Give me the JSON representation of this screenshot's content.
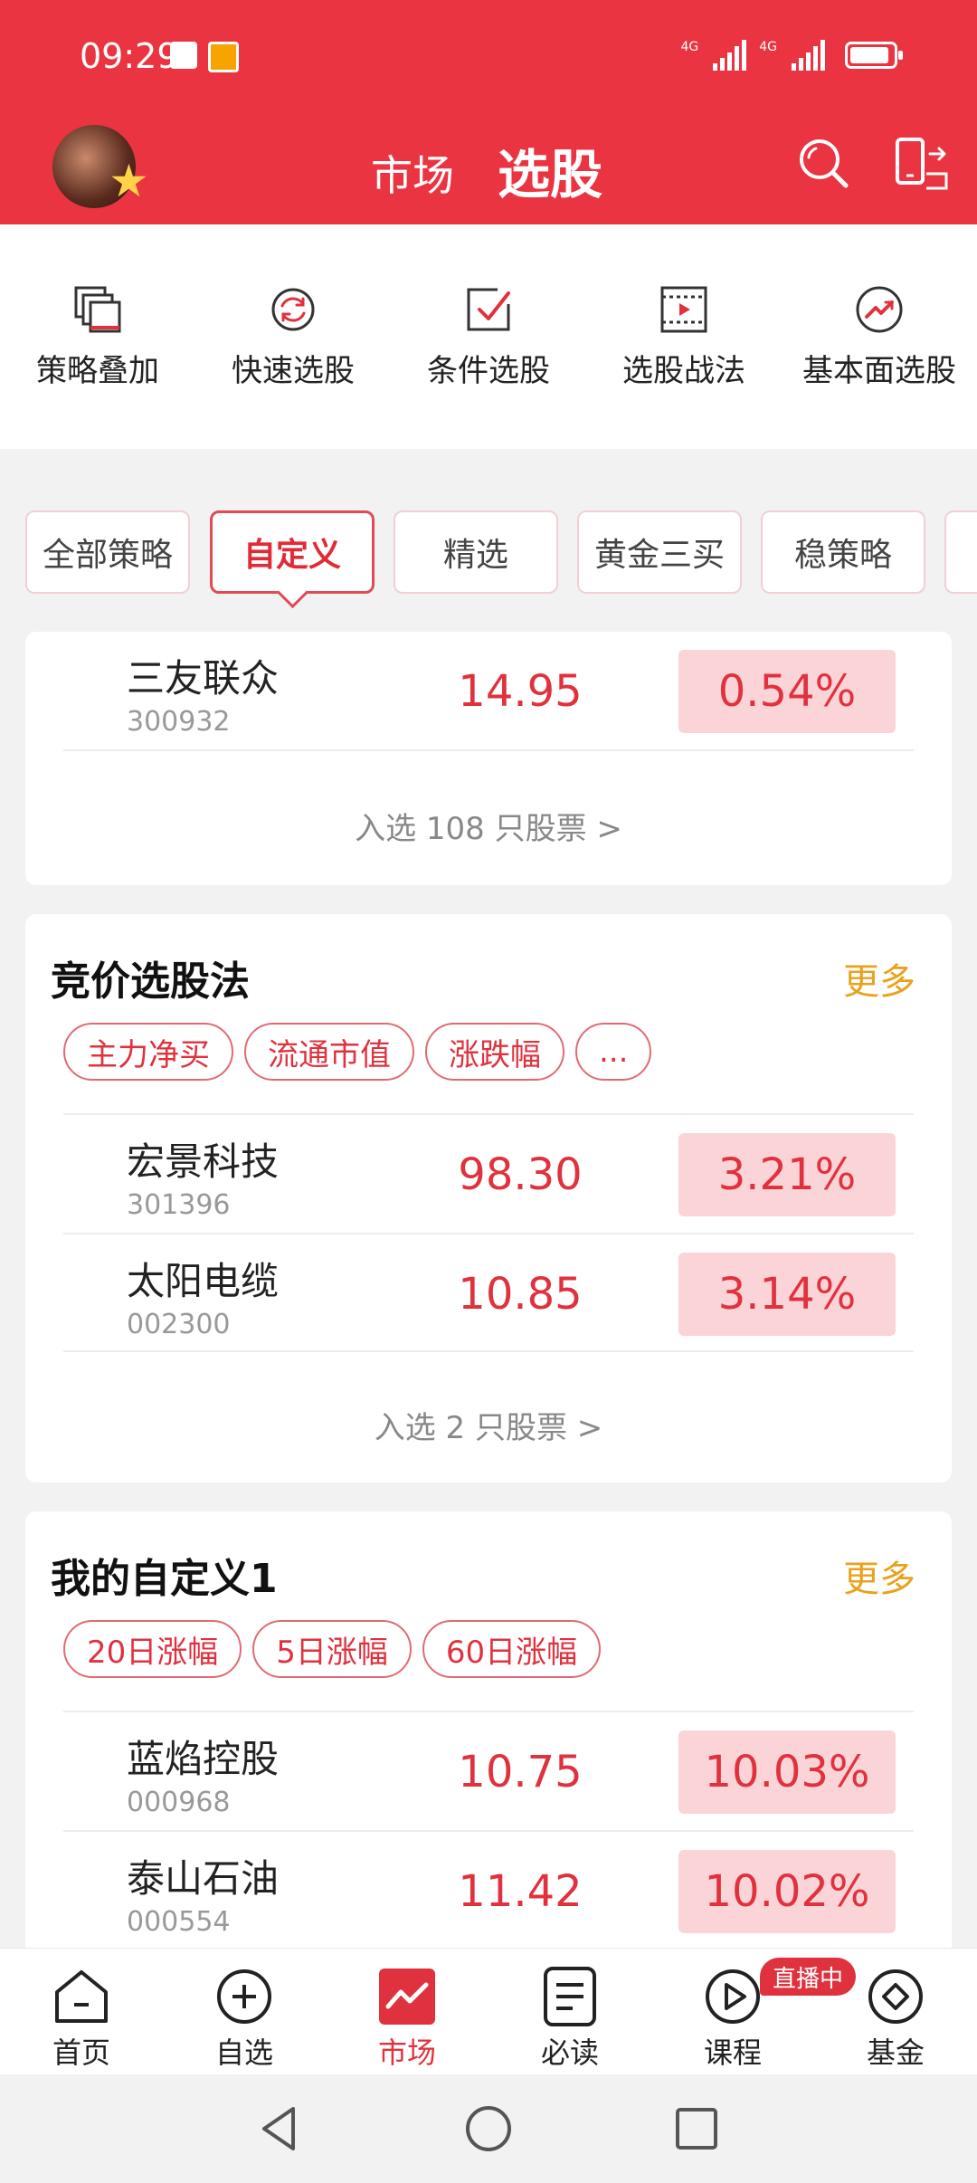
{
  "status": {
    "time": "09:29",
    "net1": "4G",
    "net2": "4G"
  },
  "header": {
    "tab_market": "市场",
    "tab_pick": "选股"
  },
  "tools": [
    {
      "label": "策略叠加",
      "icon": "layers-icon"
    },
    {
      "label": "快速选股",
      "icon": "refresh-icon"
    },
    {
      "label": "条件选股",
      "icon": "check-box-icon"
    },
    {
      "label": "选股战法",
      "icon": "video-icon"
    },
    {
      "label": "基本面选股",
      "icon": "trend-circle-icon"
    }
  ],
  "strategy_tabs": [
    "全部策略",
    "自定义",
    "精选",
    "黄金三买",
    "稳策略"
  ],
  "card1": {
    "rows": [
      {
        "name": "三友联众",
        "code": "300932",
        "price": "14.95",
        "change": "0.54%"
      }
    ],
    "selected_link": "入选 108 只股票 >"
  },
  "card2": {
    "title": "竞价选股法",
    "more": "更多",
    "chips": [
      "主力净买",
      "流通市值",
      "涨跌幅",
      "..."
    ],
    "rows": [
      {
        "name": "宏景科技",
        "code": "301396",
        "price": "98.30",
        "change": "3.21%"
      },
      {
        "name": "太阳电缆",
        "code": "002300",
        "price": "10.85",
        "change": "3.14%"
      }
    ],
    "selected_link": "入选 2 只股票 >"
  },
  "card3": {
    "title": "我的自定义1",
    "more": "更多",
    "chips": [
      "20日涨幅",
      "5日涨幅",
      "60日涨幅"
    ],
    "rows": [
      {
        "name": "蓝焰控股",
        "code": "000968",
        "price": "10.75",
        "change": "10.03%"
      },
      {
        "name": "泰山石油",
        "code": "000554",
        "price": "11.42",
        "change": "10.02%"
      }
    ]
  },
  "bottom_nav": [
    {
      "label": "首页",
      "icon": "home-icon"
    },
    {
      "label": "自选",
      "icon": "plus-circle-icon"
    },
    {
      "label": "市场",
      "icon": "market-chart-icon"
    },
    {
      "label": "必读",
      "icon": "document-icon"
    },
    {
      "label": "课程",
      "icon": "play-circle-icon"
    },
    {
      "label": "基金",
      "icon": "diamond-circle-icon"
    }
  ],
  "live_badge": "直播中",
  "colors": {
    "brand_red": "#ea3441",
    "up_red": "#e0323e",
    "more_gold": "#e8a21c",
    "pct_bg": "#fbd4d7"
  }
}
